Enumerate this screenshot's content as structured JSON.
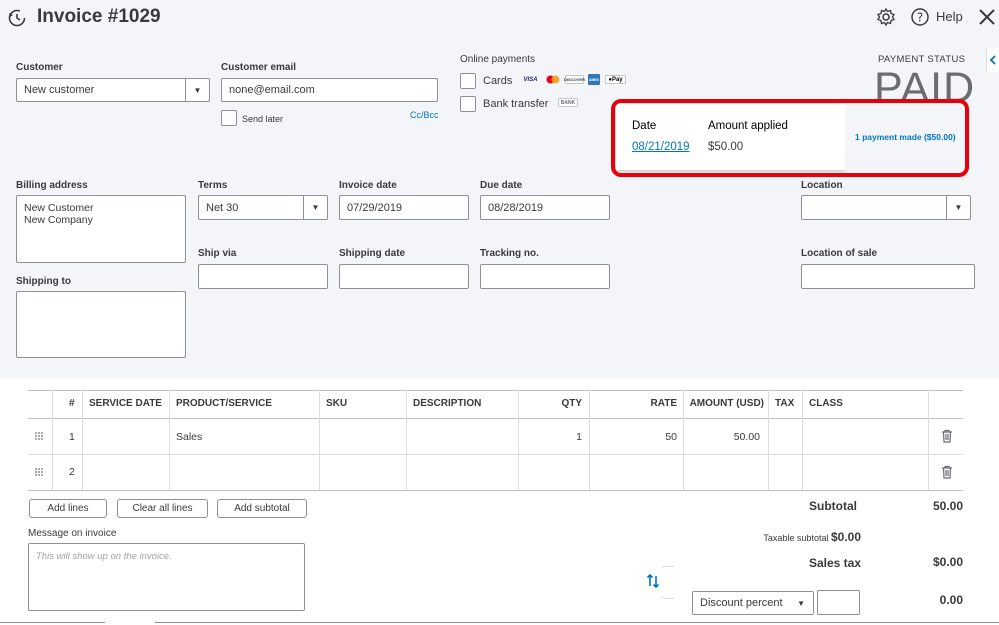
{
  "header": {
    "title": "Invoice #1029",
    "help_label": "Help"
  },
  "customer": {
    "label": "Customer",
    "value": "New customer"
  },
  "customer_email": {
    "label": "Customer email",
    "value": "none@email.com",
    "cc_bcc": "Cc/Bcc",
    "send_later": "Send later"
  },
  "online_payments": {
    "label": "Online payments",
    "cards_label": "Cards",
    "bank_label": "Bank transfer",
    "logos": [
      "VISA",
      "MC",
      "DISCOVER",
      "AMEX",
      "Pay"
    ],
    "bank_logo": "BANK"
  },
  "payment_status": {
    "label": "PAYMENT STATUS",
    "value": "PAID"
  },
  "payment_popup": {
    "date_header": "Date",
    "amount_header": "Amount applied",
    "date": "08/21/2019",
    "amount": "$50.00",
    "summary": "1 payment made ($50.00)",
    "highlight_color": "#e8000b"
  },
  "billing": {
    "label": "Billing address",
    "line1": "New Customer",
    "line2": "New Company"
  },
  "shipping_to": {
    "label": "Shipping to"
  },
  "terms": {
    "label": "Terms",
    "value": "Net 30"
  },
  "invoice_date": {
    "label": "Invoice date",
    "value": "07/29/2019"
  },
  "due_date": {
    "label": "Due date",
    "value": "08/28/2019"
  },
  "location": {
    "label": "Location",
    "value": ""
  },
  "ship_via": {
    "label": "Ship via"
  },
  "shipping_date": {
    "label": "Shipping date"
  },
  "tracking_no": {
    "label": "Tracking no."
  },
  "location_of_sale": {
    "label": "Location of sale"
  },
  "table": {
    "headers": [
      "#",
      "SERVICE DATE",
      "PRODUCT/SERVICE",
      "SKU",
      "DESCRIPTION",
      "QTY",
      "RATE",
      "AMOUNT (USD)",
      "TAX",
      "CLASS"
    ],
    "rows": [
      {
        "num": "1",
        "service_date": "",
        "product": "Sales",
        "sku": "",
        "description": "",
        "qty": "1",
        "rate": "50",
        "amount": "50.00",
        "tax": "",
        "class": ""
      },
      {
        "num": "2",
        "service_date": "",
        "product": "",
        "sku": "",
        "description": "",
        "qty": "",
        "rate": "",
        "amount": "",
        "tax": "",
        "class": ""
      }
    ]
  },
  "actions": {
    "add_lines": "Add lines",
    "clear_all_lines": "Clear all lines",
    "add_subtotal": "Add subtotal"
  },
  "message": {
    "label": "Message on invoice",
    "placeholder": "This will show up on the invoice."
  },
  "totals": {
    "subtotal_label": "Subtotal",
    "subtotal_value": "50.00",
    "taxable_label": "Taxable subtotal",
    "taxable_value": "$0.00",
    "sales_tax_label": "Sales tax",
    "sales_tax_value": "$0.00",
    "discount_select": "Discount percent",
    "discount_value": "0.00"
  },
  "colors": {
    "link": "#0077c5",
    "background": "#f4f5f8"
  }
}
